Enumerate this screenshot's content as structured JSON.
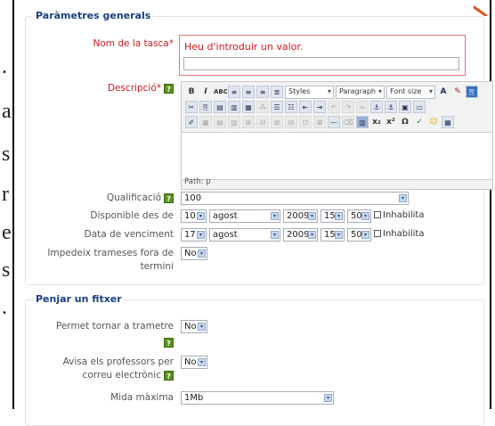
{
  "colors": {
    "section_title": "#1a3e82",
    "required_label": "#d2191f",
    "error": "#d2191f",
    "help_icon": "#5e8f22"
  },
  "doc_margin_glyphs": [
    ".",
    "a",
    "s",
    "r",
    "e",
    "s",
    "."
  ],
  "section_general": {
    "title": "Paràmetres generals",
    "task_name": {
      "label": "Nom de la tasca*",
      "error": "Heu d'introduir un valor.",
      "value": ""
    },
    "description": {
      "label": "Descripció*",
      "toolbar": {
        "styles": "Styles",
        "paragraph": "Paragraph",
        "font_size": "Font size"
      },
      "path": "Path: p"
    },
    "grade": {
      "label": "Qualificació",
      "value": "100"
    },
    "available_from": {
      "label": "Disponible des de",
      "day": "10",
      "month": "agost",
      "year": "2009",
      "hour": "15",
      "minute": "50",
      "disable": "Inhabilita"
    },
    "due_date": {
      "label": "Data de venciment",
      "day": "17",
      "month": "agost",
      "year": "2009",
      "hour": "15",
      "minute": "50",
      "disable": "Inhabilita"
    },
    "prevent_late": {
      "label_line1": "Impedeix trameses fora de",
      "label_line2": "termini",
      "value": "No"
    }
  },
  "section_upload": {
    "title": "Penjar un fitxer",
    "allow_resubmit": {
      "label": "Permet tornar a trametre",
      "value": "No"
    },
    "email_teachers": {
      "label_line1": "Avisa els professors per",
      "label_line2": "correu electrònic",
      "value": "No"
    },
    "max_size": {
      "label": "Mida màxima",
      "value": "1Mb"
    }
  }
}
